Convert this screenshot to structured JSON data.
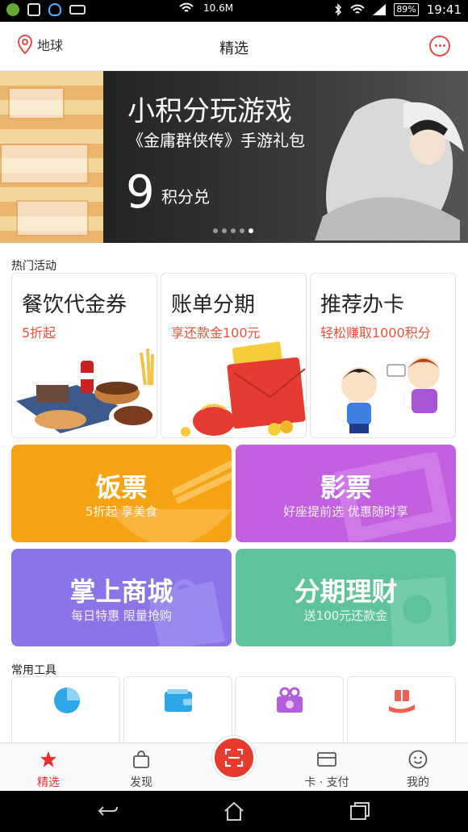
{
  "status_bar": {
    "network_speed": "10.6M",
    "battery": "89%",
    "time": "19:41"
  },
  "header": {
    "location_label": "地球",
    "title": "精选"
  },
  "banner": {
    "title": "小积分玩游戏",
    "subtitle": "《金庸群侠传》手游礼包",
    "points_number": "9",
    "points_unit": "积分兑",
    "page_count": 5,
    "active_page": 5
  },
  "hot_section": {
    "title": "热门活动",
    "cards": [
      {
        "title": "餐饮代金券",
        "subtitle": "5折起"
      },
      {
        "title": "账单分期",
        "subtitle": "享还款金100元"
      },
      {
        "title": "推荐办卡",
        "subtitle": "轻松赚取1000积分"
      }
    ]
  },
  "tiles": [
    {
      "title": "饭票",
      "subtitle": "5折起 享美食",
      "color": "#f6a313"
    },
    {
      "title": "影票",
      "subtitle": "好座提前选 优惠随时享",
      "color": "#c260e0"
    },
    {
      "title": "掌上商城",
      "subtitle": "每日特惠 限量抢购",
      "color": "#8a74e8"
    },
    {
      "title": "分期理财",
      "subtitle": "送100元还款金",
      "color": "#5ec39a"
    }
  ],
  "tools_section": {
    "title": "常用工具",
    "icons": [
      "pie-chart-icon",
      "wallet-icon",
      "gift-box-icon",
      "gift-hand-icon"
    ]
  },
  "tab_bar": {
    "tabs": [
      {
        "label": "精选",
        "icon": "star-icon",
        "active": true
      },
      {
        "label": "发现",
        "icon": "shopping-bag-icon",
        "active": false
      },
      {
        "label": "卡 · 支付",
        "icon": "card-icon",
        "active": false
      },
      {
        "label": "我的",
        "icon": "smiley-icon",
        "active": false
      }
    ],
    "center_icon": "scan-icon"
  },
  "colors": {
    "accent": "#e42f2f",
    "tag_text": "#e8503a"
  }
}
